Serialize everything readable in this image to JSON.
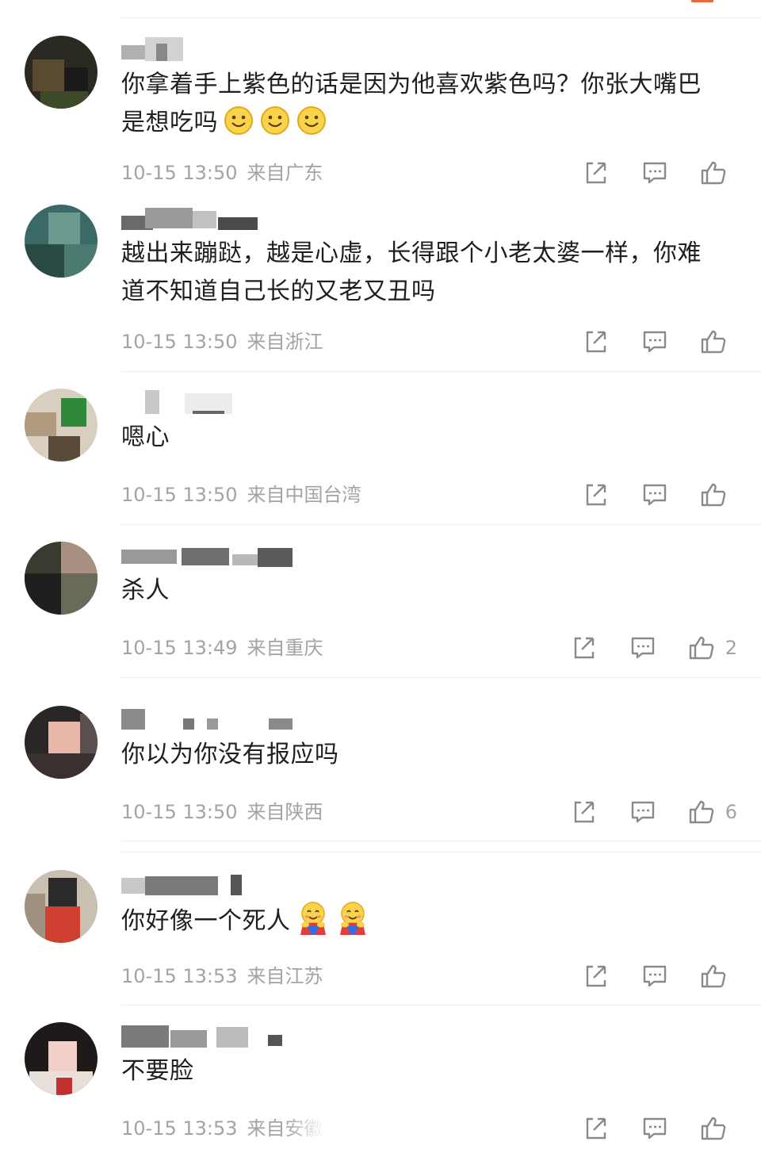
{
  "comments": [
    {
      "text": "你拿着手上紫色的话是因为他喜欢紫色吗？你张大嘴巴是想吃吗",
      "emoji": "smile",
      "emoji_count": 3,
      "time": "10-15 13:50",
      "location": "来自广东",
      "likes": ""
    },
    {
      "text": "越出来蹦跶，越是心虚，长得跟个小老太婆一样，你难道不知道自己长的又老又丑吗",
      "time": "10-15 13:50",
      "location": "来自浙江",
      "likes": ""
    },
    {
      "text": "嗯心",
      "time": "10-15 13:50",
      "location": "来自中国台湾",
      "likes": ""
    },
    {
      "text": "杀人",
      "time": "10-15 13:49",
      "location": "来自重庆",
      "likes": "2"
    },
    {
      "text": "你以为你没有报应吗",
      "time": "10-15 13:50",
      "location": "来自陕西",
      "likes": "6"
    },
    {
      "text": "你好像一个死人",
      "emoji": "hug",
      "emoji_count": 2,
      "time": "10-15 13:53",
      "location": "来自江苏",
      "likes": ""
    },
    {
      "text": "不要脸",
      "time": "10-15 13:53",
      "location": "来自安徽",
      "likes": ""
    }
  ],
  "icons": {
    "share": "share-icon",
    "reply": "reply-icon",
    "like": "thumbs-up-icon"
  },
  "colors": {
    "text": "#1f1f1f",
    "meta": "#a3a3a3",
    "icon": "#8a8a8a",
    "divider": "#ececec"
  }
}
